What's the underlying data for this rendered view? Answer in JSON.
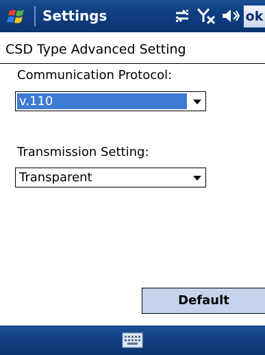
{
  "titlebar": {
    "title": "Settings",
    "ok_label": "ok",
    "icons": [
      "windows-start-icon",
      "connectivity-icon",
      "signal-off-icon",
      "speaker-icon"
    ]
  },
  "page": {
    "heading": "CSD Type Advanced Setting"
  },
  "fields": {
    "protocol": {
      "label": "Communication Protocol:",
      "value": "v.110"
    },
    "transmission": {
      "label": "Transmission Setting:",
      "value": "Transparent"
    }
  },
  "buttons": {
    "default_label": "Default"
  },
  "bottombar": {
    "icon": "keyboard-icon"
  },
  "colors": {
    "titlebar": "#0f3f83",
    "selection": "#3d7bd4",
    "button_bg": "#c4d4ec"
  }
}
